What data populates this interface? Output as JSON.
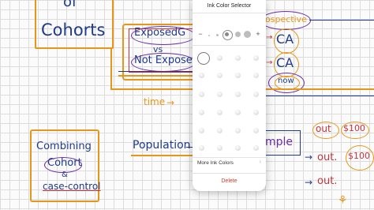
{
  "popover": {
    "title": "Ink Color Selector",
    "minus": "−",
    "plus": "+",
    "more_label": "More Ink Colors",
    "more_chevron": "›",
    "delete_label": "Delete"
  },
  "notes": {
    "top_left": "of",
    "cohorts": "Cohorts",
    "exposed": "ExposedG",
    "vs": "vs",
    "not_exposed": "Not Expose",
    "time": "time",
    "combining": "Combining",
    "cohort": "Cohort",
    "amp": "&",
    "case_control": "case-control",
    "population": "Population",
    "sample": "mple",
    "prospective": "ospective",
    "ca1": "CA",
    "ca2": "CA",
    "now": "now",
    "out1": "out",
    "price1": "$100",
    "out2": "out.",
    "price2": "$100",
    "out3": "out."
  },
  "colors": {
    "orange": "#e8961a",
    "blue": "#1f3a8a",
    "purple": "#6a2ca8",
    "red": "#c8323a",
    "delete": "#d23a2d"
  }
}
